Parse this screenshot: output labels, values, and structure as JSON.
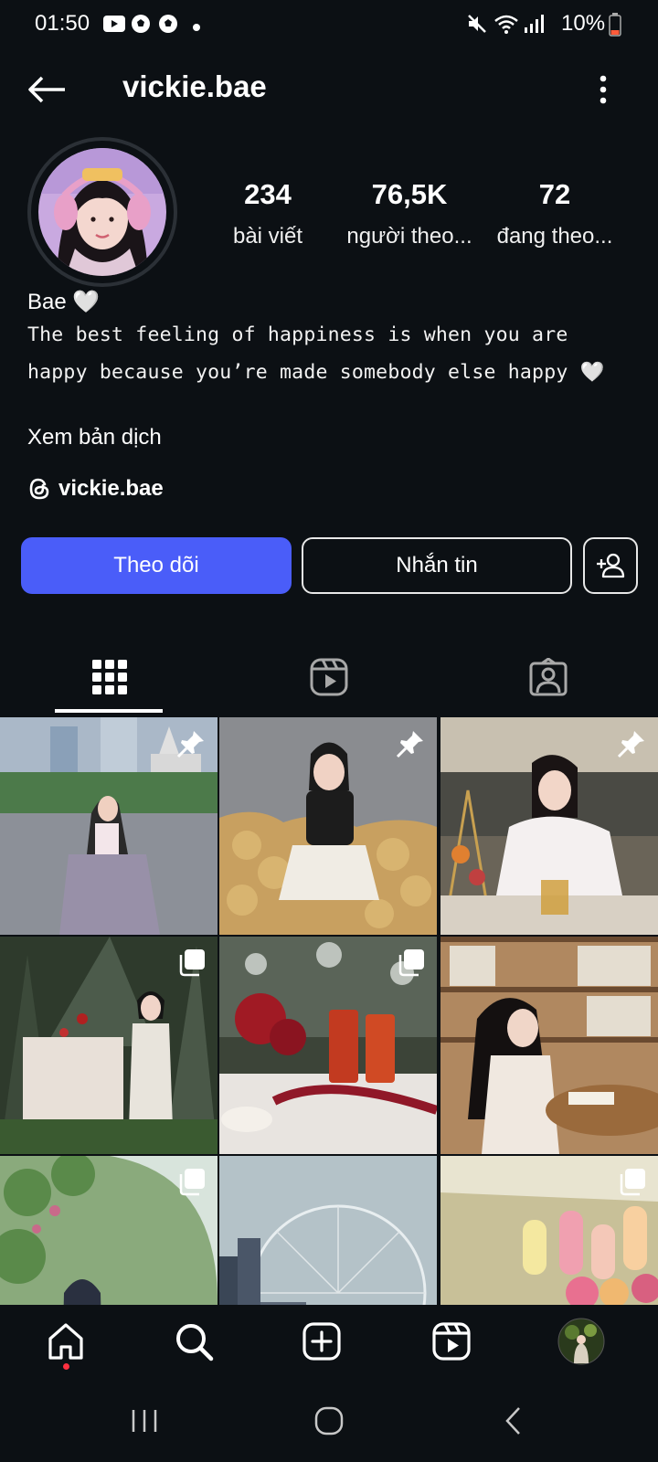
{
  "status_bar": {
    "time": "01:50",
    "battery": "10%",
    "notification_icons": [
      "youtube-icon",
      "soccer-icon",
      "soccer-icon",
      "dot-icon"
    ],
    "system_icons": [
      "mute-icon",
      "wifi-icon",
      "signal-icon",
      "battery-low-icon"
    ],
    "battery_color": "#ff5b3a"
  },
  "header": {
    "username": "vickie.bae"
  },
  "profile": {
    "stats": [
      {
        "value": "234",
        "label": "bài viết"
      },
      {
        "value": "76,5K",
        "label": "người theo..."
      },
      {
        "value": "72",
        "label": "đang theo..."
      }
    ],
    "display_name": "Bae 🤍",
    "bio": "The best feeling of happiness is when you are happy because you’re made somebody else happy 🤍",
    "translate_label": "Xem bản dịch",
    "threads_handle": "vickie.bae"
  },
  "actions": {
    "follow_label": "Theo dõi",
    "message_label": "Nhắn tin"
  },
  "tabs": [
    {
      "icon": "grid-icon",
      "active": true
    },
    {
      "icon": "reels-icon",
      "active": false
    },
    {
      "icon": "tagged-icon",
      "active": false
    }
  ],
  "posts": [
    {
      "overlay": "pin-icon",
      "scene": "street-temple"
    },
    {
      "overlay": "pin-icon",
      "scene": "bread-pile"
    },
    {
      "overlay": "pin-icon",
      "scene": "tea-lounge"
    },
    {
      "overlay": "carousel-icon",
      "scene": "christmas-dinner"
    },
    {
      "overlay": "carousel-icon",
      "scene": "roses-drinks"
    },
    {
      "overlay": "none",
      "scene": "library"
    },
    {
      "overlay": "carousel-icon",
      "scene": "garden-dome"
    },
    {
      "overlay": "none",
      "scene": "ferris-wheel"
    },
    {
      "overlay": "carousel-icon",
      "scene": "pastel-lamps"
    }
  ],
  "bottom_nav": [
    "home-icon",
    "search-icon",
    "create-icon",
    "reels-icon",
    "profile-avatar"
  ],
  "colors": {
    "background": "#0c1014",
    "follow_button": "#4a5df9",
    "notification_dot": "#ff3040"
  }
}
